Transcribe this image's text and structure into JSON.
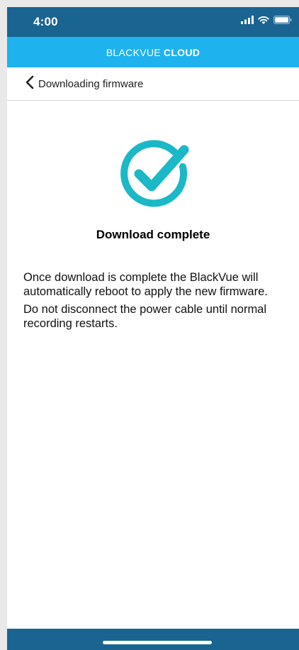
{
  "status_bar": {
    "time": "4:00",
    "icons": [
      "cellular-signal-icon",
      "wifi-icon",
      "battery-icon"
    ]
  },
  "app_header": {
    "brand_regular": "BLACKVUE",
    "brand_bold": "CLOUD"
  },
  "nav": {
    "back_icon": "chevron-left-icon",
    "title": "Downloading firmware"
  },
  "main": {
    "status_icon": "check-circle-icon",
    "headline": "Download complete",
    "paragraph_1": "Once download is complete the BlackVue will automatically reboot to apply the new firmware.",
    "paragraph_2": "Do not disconnect the power cable until normal recording restarts."
  },
  "colors": {
    "status_bar_bg": "#1a6491",
    "header_bg": "#1eb2ef",
    "accent_check": "#1bb8c7",
    "bottom_bar_bg": "#1a6491"
  }
}
